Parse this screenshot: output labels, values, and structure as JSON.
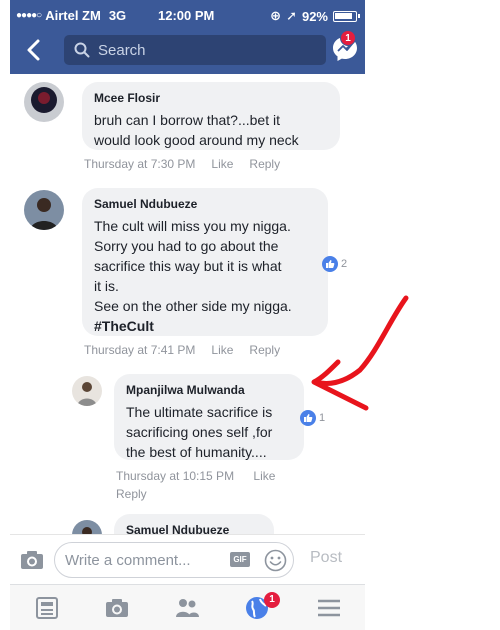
{
  "status_bar": {
    "carrier": "Airtel ZM",
    "network": "3G",
    "time": "12:00 PM",
    "battery": "92%"
  },
  "nav": {
    "search_placeholder": "Search",
    "messenger_badge": "1"
  },
  "comments": [
    {
      "author": "Mcee Flosir",
      "lines": [
        "bruh can I borrow that?...bet it",
        "would look good around my neck"
      ],
      "time": "Thursday at 7:30 PM",
      "like_label": "Like",
      "reply_label": "Reply",
      "reactions": ""
    },
    {
      "author": "Samuel Ndubueze",
      "lines": [
        "The cult will miss you my nigga.",
        "Sorry you had to go about the",
        "sacrifice this way but it is what",
        "it is.",
        "See on the other side my nigga.",
        "#TheCult"
      ],
      "time": "Thursday at 7:41 PM",
      "like_label": "Like",
      "reply_label": "Reply",
      "reactions": "2"
    },
    {
      "author": "Mpanjilwa Mulwanda",
      "lines": [
        "The ultimate sacrifice is",
        "sacrificing ones self ,for",
        "the best of humanity...."
      ],
      "time": "Thursday at 10:15 PM",
      "like_label": "Like",
      "reply_label": "Reply",
      "reactions": "1"
    },
    {
      "author": "Samuel Ndubueze"
    }
  ],
  "composer": {
    "placeholder": "Write a comment...",
    "gif_label": "GIF",
    "post_label": "Post"
  },
  "tabbar": {
    "notifications_badge": "1"
  },
  "colors": {
    "facebook_blue": "#3b5998",
    "annotation_arrow": "#e8141c",
    "badge_red": "#e41e3f"
  },
  "icons": [
    "back-arrow-icon",
    "search-icon",
    "messenger-icon",
    "camera-icon",
    "gif-icon",
    "emoji-icon",
    "news-feed-icon",
    "friends-icon",
    "globe-icon",
    "menu-icon",
    "thumbs-up-icon"
  ]
}
